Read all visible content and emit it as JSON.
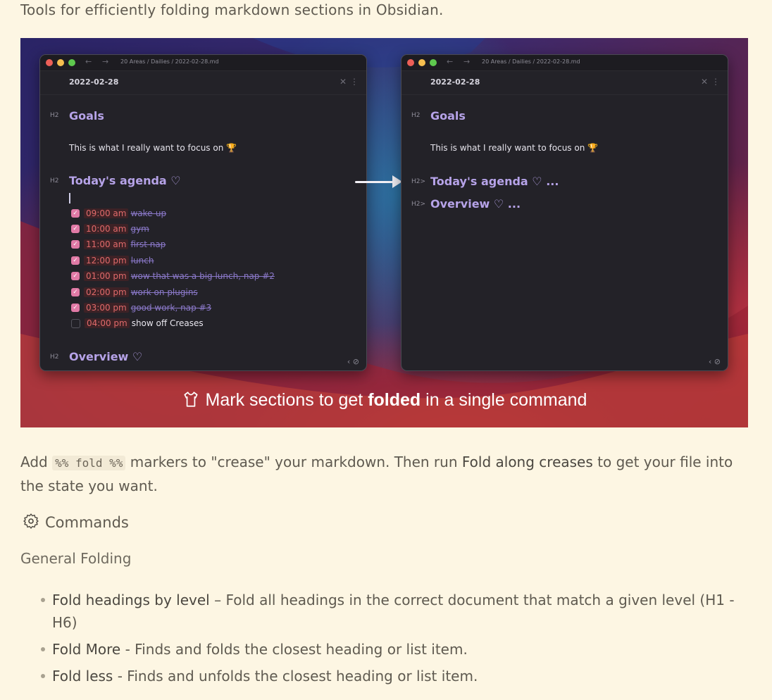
{
  "intro": "Tools for efficiently folding markdown sections in Obsidian.",
  "screenshot": {
    "left_window": {
      "breadcrumb": "20 Areas /  Dailies /  2022-02-28.md",
      "doc_title": "2022-02-28",
      "goals": {
        "mark": "H2",
        "heading": "Goals"
      },
      "goals_text": "This is what I really want to focus on 🏆",
      "agenda": {
        "mark": "H2",
        "heading": "Today's agenda ♡"
      },
      "tasks": [
        {
          "time": "09:00 am",
          "text": "wake-up",
          "done": true
        },
        {
          "time": "10:00 am",
          "text": "gym",
          "done": true
        },
        {
          "time": "11:00 am",
          "text": "first nap",
          "done": true
        },
        {
          "time": "12:00 pm",
          "text": "lunch",
          "done": true
        },
        {
          "time": "01:00 pm",
          "text": "wow that was a big lunch, nap #2",
          "done": true
        },
        {
          "time": "02:00 pm",
          "text": "work on plugins",
          "done": true
        },
        {
          "time": "03:00 pm",
          "text": "good work, nap #3",
          "done": true
        },
        {
          "time": "04:00 pm",
          "text": "show off Creases",
          "done": false
        }
      ],
      "overview": {
        "mark": "H2",
        "heading": "Overview ♡"
      }
    },
    "right_window": {
      "breadcrumb": "20 Areas /  Dailies /  2022-02-28.md",
      "doc_title": "2022-02-28",
      "goals": {
        "mark": "H2",
        "heading": "Goals"
      },
      "goals_text": "This is what I really want to focus on 🏆",
      "agenda": {
        "mark": "H2>",
        "heading": "Today's agenda ♡ ..."
      },
      "overview": {
        "mark": "H2>",
        "heading": "Overview ♡ ..."
      }
    },
    "caption": {
      "icon": "shirt-icon",
      "before": "Mark sections to get ",
      "bold": "folded",
      "after": " in a single command"
    },
    "colors": {
      "heading": "#b6a3e8",
      "check": "#e07aa6",
      "time": "#e06a6a"
    }
  },
  "paragraph": {
    "part1": "Add ",
    "code": "%% fold %%",
    "part2": " markers to \"crease\" your markdown. Then run ",
    "command": "Fold along creases",
    "part3": " to get your file into the state you want."
  },
  "commands": {
    "icon": "gear-icon",
    "label": "Commands"
  },
  "subheading": "General Folding",
  "list": [
    {
      "name": "Fold headings by level",
      "sep": " – ",
      "desc": "Fold all headings in the correct document that match a given level (H1 - H6)"
    },
    {
      "name": "Fold More",
      "sep": " - ",
      "desc": "Finds and folds the closest heading or list item."
    },
    {
      "name": "Fold less",
      "sep": " - ",
      "desc": "Finds and unfolds the closest heading or list item."
    }
  ]
}
